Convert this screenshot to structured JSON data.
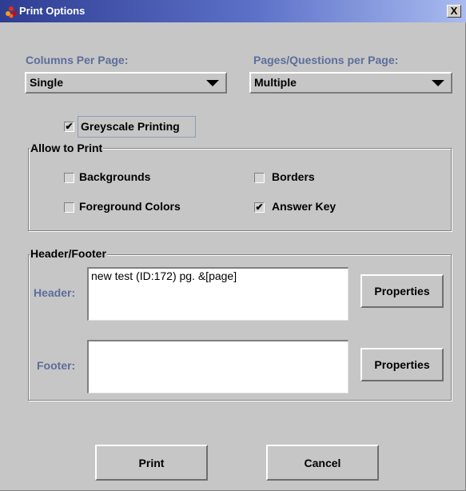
{
  "window": {
    "title": "Print Options",
    "close_label": "X"
  },
  "layout_options": {
    "columns_label": "Columns Per Page:",
    "columns_value": "Single",
    "pages_label": "Pages/Questions per Page:",
    "pages_value": "Multiple"
  },
  "greyscale": {
    "label": "Greyscale Printing",
    "checked": true
  },
  "allow_to_print": {
    "title": "Allow to Print",
    "items": [
      {
        "label": "Backgrounds",
        "checked": false
      },
      {
        "label": "Borders",
        "checked": false
      },
      {
        "label": "Foreground Colors",
        "checked": false
      },
      {
        "label": "Answer Key",
        "checked": true
      }
    ]
  },
  "header_footer": {
    "title": "Header/Footer",
    "header_label": "Header:",
    "header_value": "new test (ID:172) pg. &[page]",
    "footer_label": "Footer:",
    "footer_value": "",
    "properties_label": "Properties"
  },
  "buttons": {
    "print": "Print",
    "cancel": "Cancel"
  },
  "check_mark": "✔",
  "colors": {
    "titlebar_start": "#2e3d92",
    "titlebar_end": "#a9bbf0",
    "label_blue": "#5c6e9b",
    "dialog_bg": "#c6c6c6"
  }
}
